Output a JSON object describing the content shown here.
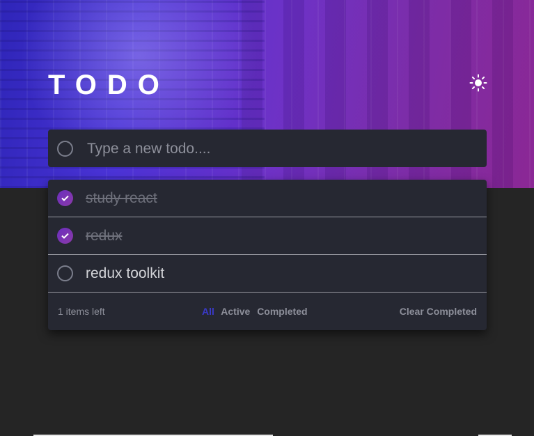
{
  "header": {
    "title": "TODO",
    "theme_icon": "sun-icon"
  },
  "new_todo": {
    "placeholder": "Type a new todo....",
    "value": ""
  },
  "todos": [
    {
      "text": "study react",
      "completed": true
    },
    {
      "text": "redux",
      "completed": true
    },
    {
      "text": "redux toolkit",
      "completed": false
    }
  ],
  "footer": {
    "items_left": "1 items left",
    "filters": [
      "All",
      "Active",
      "Completed"
    ],
    "active_filter": "All",
    "clear_label": "Clear Completed"
  },
  "colors": {
    "background": "#252525",
    "card": "#262832",
    "accent_active_filter": "#3a3ac8",
    "check_gradient_start": "#6a2ebf",
    "check_gradient_end": "#8b3aa8"
  }
}
